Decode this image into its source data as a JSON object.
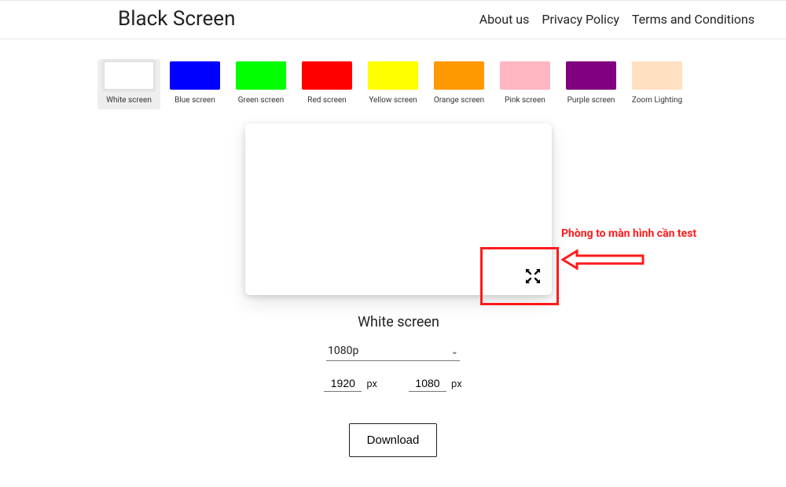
{
  "header": {
    "brand": "Black Screen",
    "nav": [
      "About us",
      "Privacy Policy",
      "Terms and Conditions"
    ]
  },
  "swatches": [
    {
      "label": "White screen",
      "color": "#ffffff",
      "selected": true
    },
    {
      "label": "Blue screen",
      "color": "#0000ff"
    },
    {
      "label": "Green screen",
      "color": "#00ff00"
    },
    {
      "label": "Red screen",
      "color": "#ff0000"
    },
    {
      "label": "Yellow screen",
      "color": "#ffff00"
    },
    {
      "label": "Orange screen",
      "color": "#ff9900"
    },
    {
      "label": "Pink screen",
      "color": "#ffb6c1"
    },
    {
      "label": "Purple screen",
      "color": "#800080"
    },
    {
      "label": "Zoom Lighting",
      "color": "#ffe0c0"
    }
  ],
  "preview": {
    "title": "White screen",
    "annotation_text": "Phòng to màn hình cần test"
  },
  "resolution": {
    "preset": "1080p",
    "width": "1920",
    "height": "1080",
    "unit": "px"
  },
  "download_label": "Download"
}
